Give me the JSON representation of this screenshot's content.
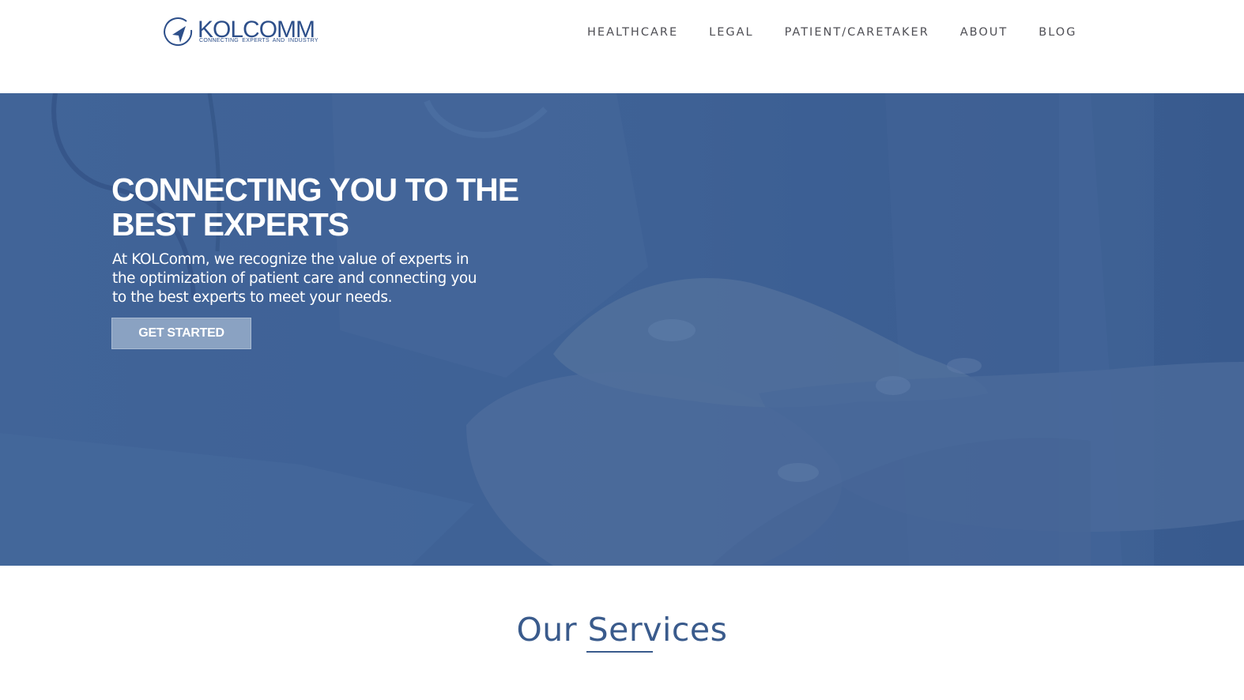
{
  "header": {
    "logo": {
      "wordmark": "KOLCOMM",
      "tagline": "CONNECTING EXPERTS AND INDUSTRY",
      "icon": "compass-arrow-icon"
    },
    "nav": [
      {
        "label": "HEALTHCARE"
      },
      {
        "label": "LEGAL"
      },
      {
        "label": "PATIENT/CARETAKER"
      },
      {
        "label": "ABOUT"
      },
      {
        "label": "BLOG"
      }
    ]
  },
  "hero": {
    "title": "CONNECTING YOU TO THE BEST EXPERTS",
    "subtitle": "At KOLComm, we recognize the value of experts in the optimization of patient care and connecting you to the best experts to meet your needs.",
    "cta_label": "GET STARTED",
    "image": "hands-holding-background"
  },
  "services": {
    "title": "Our Services"
  },
  "colors": {
    "brand": "#2d4f8a",
    "hero_overlay": "#3e6193",
    "cta_bg": "#8aa2c2",
    "nav_text": "#4f4f55",
    "heading": "#3a5b8c"
  }
}
